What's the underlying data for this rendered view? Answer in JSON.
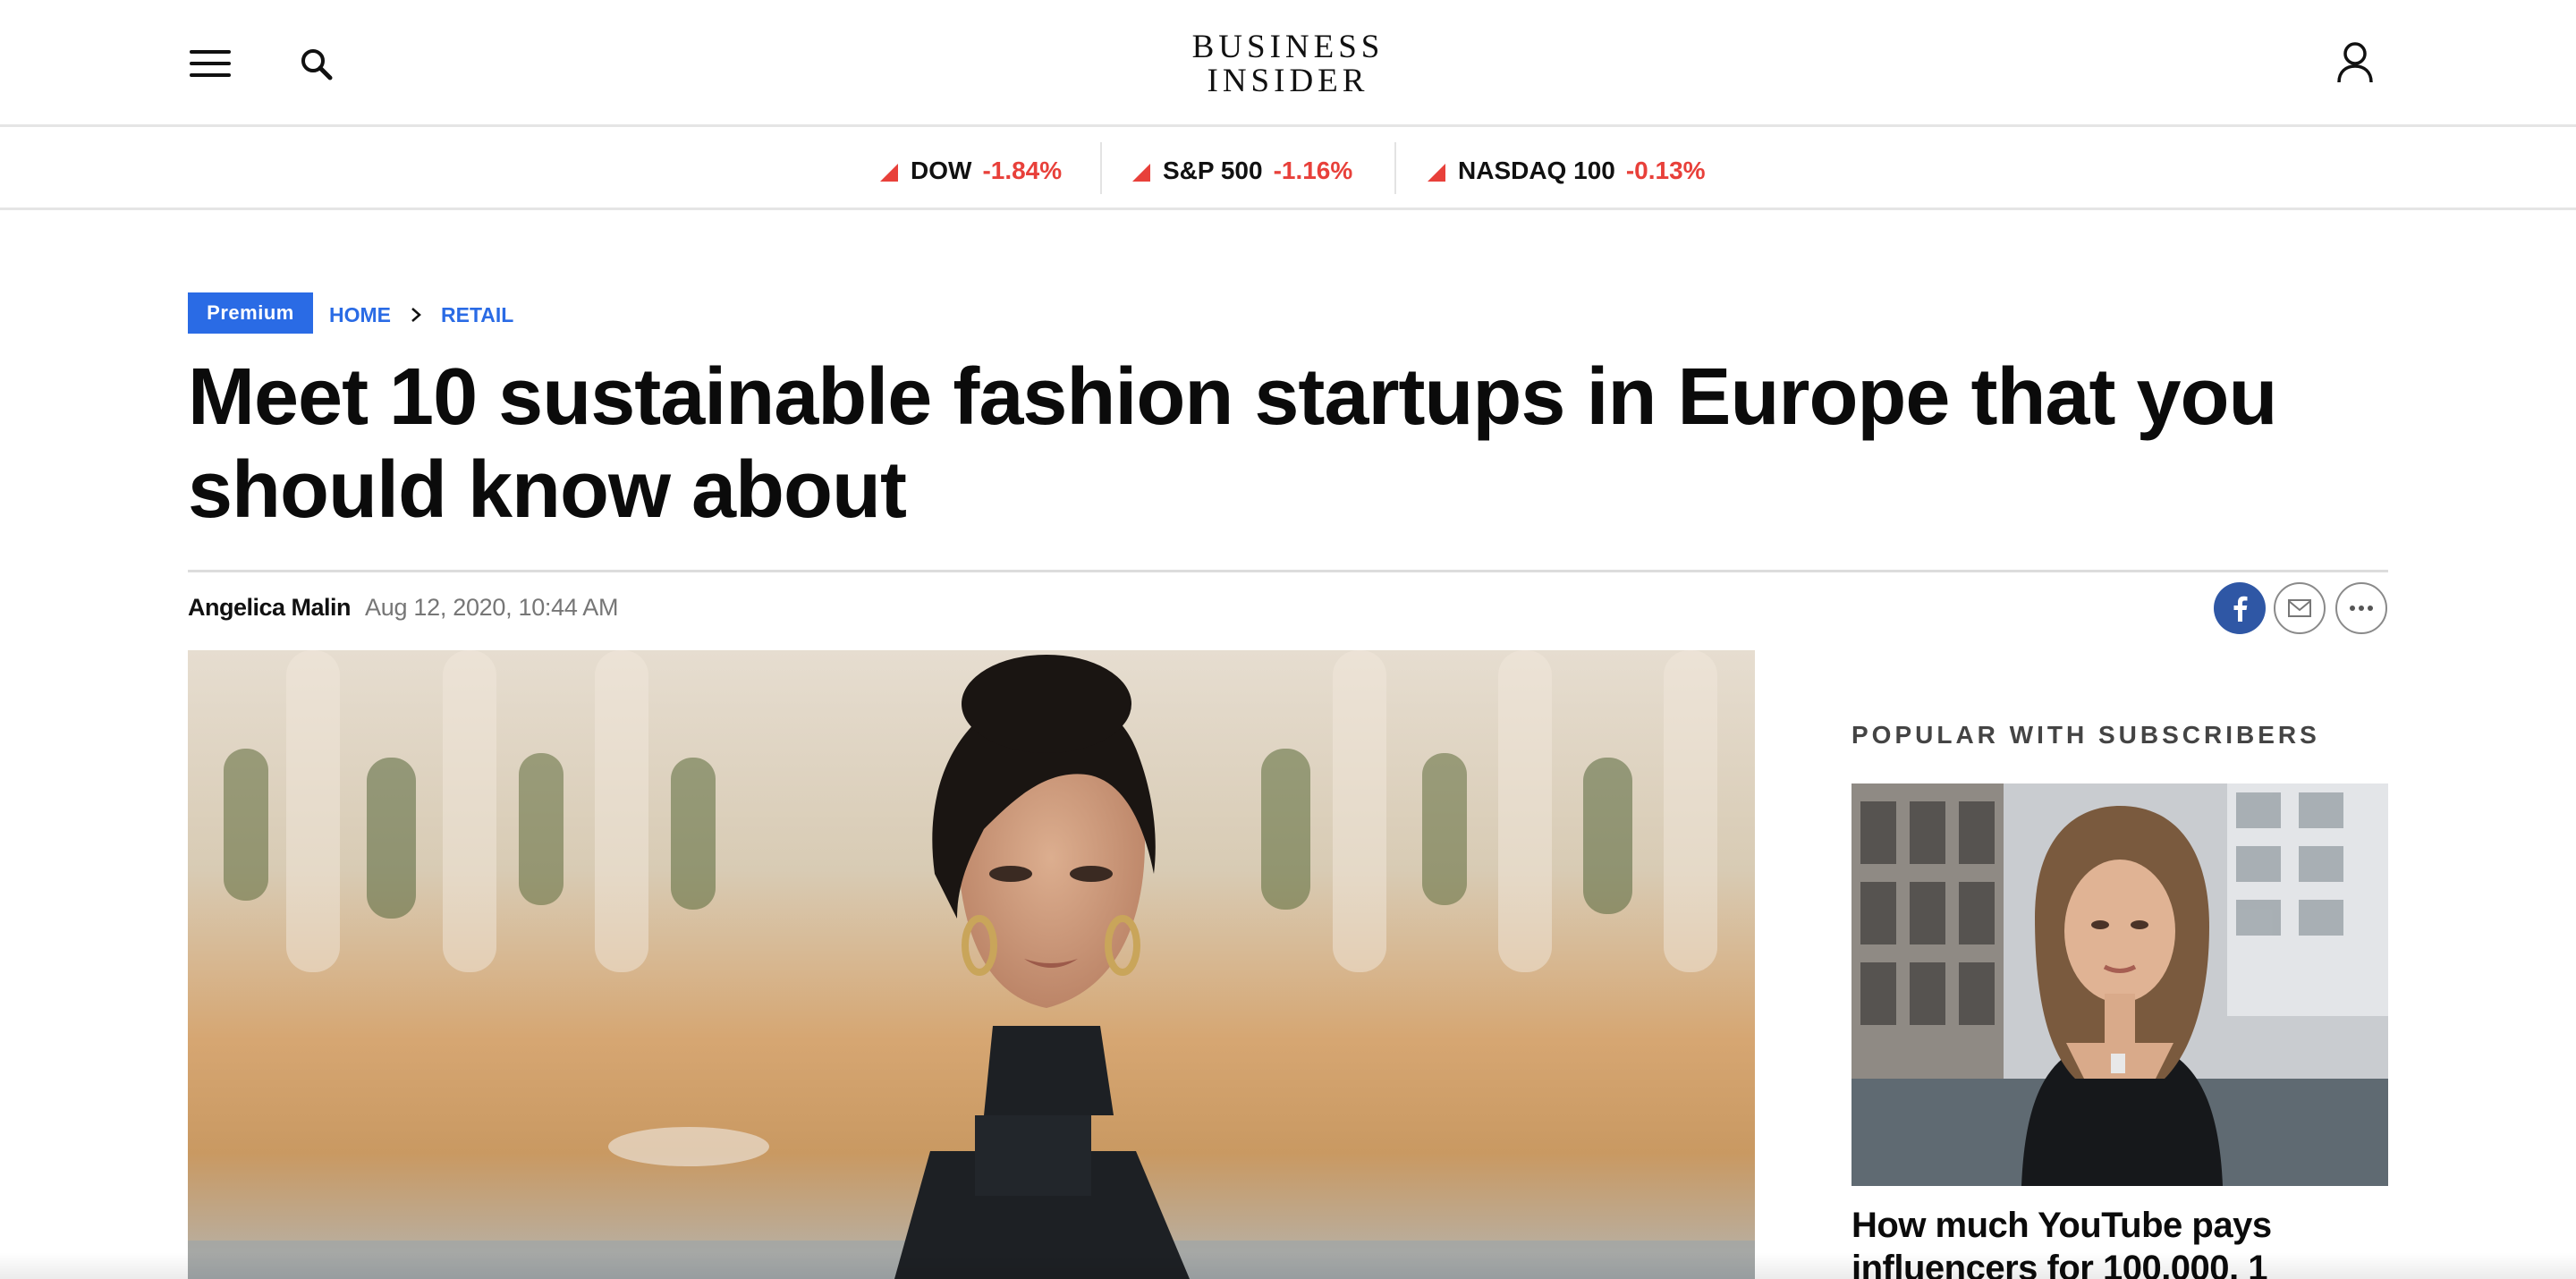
{
  "header": {
    "logo_line1": "BUSINESS",
    "logo_line2": "INSIDER",
    "icons": [
      "hamburger-menu-icon",
      "search-icon",
      "user-icon"
    ]
  },
  "ticker": [
    {
      "name": "DOW",
      "change": "-1.84%",
      "direction": "down"
    },
    {
      "name": "S&P 500",
      "change": "-1.16%",
      "direction": "down"
    },
    {
      "name": "NASDAQ 100",
      "change": "-0.13%",
      "direction": "down"
    }
  ],
  "article": {
    "badge": "Premium",
    "breadcrumb": [
      "HOME",
      "RETAIL"
    ],
    "headline_line1": "Meet 10 sustainable fashion startups in Europe that you",
    "headline_line2": "should know about",
    "author": "Angelica Malin",
    "date": "Aug 12, 2020, 10:44 AM",
    "share_icons": [
      "facebook-icon",
      "email-icon",
      "more-icon"
    ]
  },
  "sidebar": {
    "title": "POPULAR WITH SUBSCRIBERS",
    "story_headline": "How much YouTube pays influencers for 100,000, 1"
  },
  "colors": {
    "accent_blue": "#2a6be5",
    "down_red": "#e8403a",
    "facebook_blue": "#2f57a5"
  }
}
